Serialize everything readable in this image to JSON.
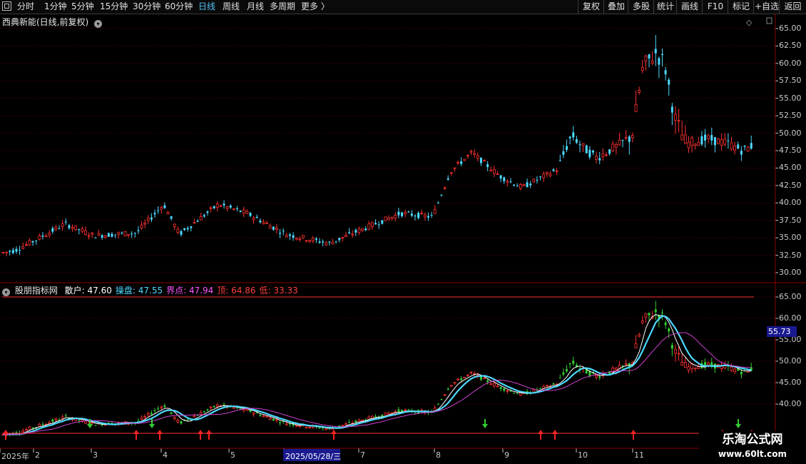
{
  "toolbar": {
    "left_items": [
      "分时",
      "1分钟",
      "5分钟",
      "15分钟",
      "30分钟",
      "60分钟",
      "日线",
      "周线",
      "月线",
      "多周期",
      "更多 〉"
    ],
    "active": "日线",
    "right_items": [
      "复权",
      "叠加",
      "多股",
      "统计",
      "画线",
      "F10",
      "标记",
      "+自选",
      "返回"
    ]
  },
  "main_panel": {
    "title": "西典新能(日线,前复权)",
    "price_ticks": [
      "65.00",
      "62.50",
      "60.00",
      "57.50",
      "55.00",
      "52.50",
      "50.00",
      "47.50",
      "45.00",
      "42.50",
      "40.00",
      "37.50",
      "35.00",
      "32.50",
      "30.00"
    ]
  },
  "indicator_panel": {
    "name": "股朋指标网",
    "values": [
      {
        "label": "散户: 47.60",
        "color": "#ffffff"
      },
      {
        "label": "操盘: 47.55",
        "color": "#4dd8ff"
      },
      {
        "label": "界点: 47.94",
        "color": "#ff55ff"
      },
      {
        "label": "顶: 64.86",
        "color": "#ff4040"
      },
      {
        "label": "低: 33.33",
        "color": "#ff4040"
      }
    ],
    "ticks": [
      "65.00",
      "60.00",
      "55.00",
      "50.00",
      "45.00",
      "40.00"
    ],
    "current_value": "55.73"
  },
  "date_axis": [
    "2025年",
    "2",
    "3",
    "4",
    "5",
    "2025/05/28/三",
    "7",
    "8",
    "9",
    "10",
    "11"
  ],
  "watermark": {
    "line1": "乐淘公式网",
    "line2": "www.60lt.com"
  },
  "colors": {
    "up": "#ff3030",
    "down": "#4dd8ff",
    "grid": "#8b0000",
    "ma_white": "#ffffff",
    "ma_cyan": "#4dd8ff",
    "ma_magenta": "#d040d0"
  }
}
